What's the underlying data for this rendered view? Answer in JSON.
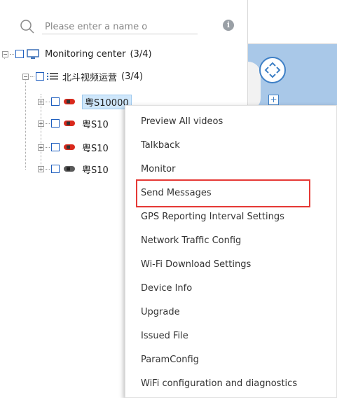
{
  "search": {
    "placeholder": "Please enter a name o"
  },
  "tree": {
    "root": {
      "label": "Monitoring center",
      "count": "(3/4)"
    },
    "group": {
      "label": "北斗视频运营",
      "count": "(3/4)"
    },
    "vehicles": [
      {
        "label": "粤S10000",
        "status": "online",
        "selected": true
      },
      {
        "label": "粤S10",
        "status": "online",
        "selected": false
      },
      {
        "label": "粤S10",
        "status": "online",
        "selected": false
      },
      {
        "label": "粤S10",
        "status": "offline",
        "selected": false
      }
    ]
  },
  "context_menu": {
    "items": [
      "Preview All videos",
      "Talkback",
      "Monitor",
      "Send Messages",
      "GPS Reporting Interval Settings",
      "Network Traffic Config",
      "Wi-Fi Download Settings",
      "Device Info",
      "Upgrade",
      "Issued File",
      "ParamConfig",
      "WiFi configuration and diagnostics"
    ],
    "highlighted_item": "Send Messages"
  },
  "colors": {
    "highlight_border": "#e53935",
    "checkbox": "#1f5fbf",
    "map_water": "#a9c8e8",
    "car_online": "#d9291c",
    "car_offline": "#5a5a5a"
  },
  "map": {
    "zoom_in_label": "+"
  }
}
